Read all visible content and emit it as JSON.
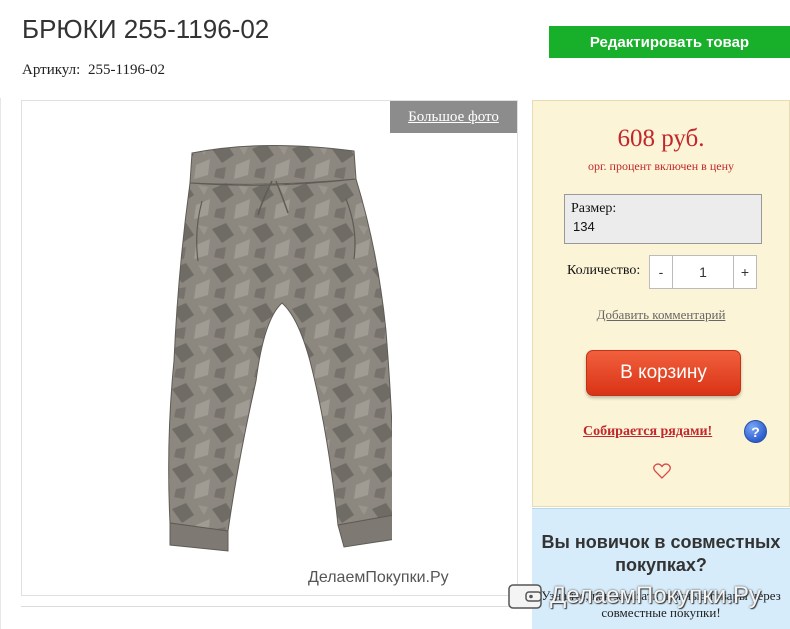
{
  "product": {
    "title": "БРЮКИ 255-1196-02",
    "sku_label": "Артикул:",
    "sku_value": "255-1196-02"
  },
  "actions": {
    "edit_label": "Редактировать товар",
    "big_photo_label": "Большое фото"
  },
  "image": {
    "watermark": "ДелаемПокупки.Ру"
  },
  "buy": {
    "price": "608 руб.",
    "price_note": "орг. процент включен в цену",
    "size_label": "Размер:",
    "size_value": "134",
    "quantity_label": "Количество:",
    "quantity_minus": "-",
    "quantity_value": "1",
    "quantity_plus": "+",
    "add_comment": "Добавить комментарий",
    "cart_label": "В корзину",
    "collect_link": "Собирается рядами!",
    "help_symbol": "?"
  },
  "newbie": {
    "title": "Вы новичок в совместных покупках?",
    "text": "Узнайте, как заказать нужные товары через совместные покупки!"
  },
  "brand_watermark": "ДелаемПокупки.Ру",
  "colors": {
    "edit_button": "#18b02b",
    "price": "#c1272d",
    "buy_panel": "#fcf4d6",
    "newbie_panel": "#d6ecfa",
    "cart_button": "#e2431f"
  }
}
